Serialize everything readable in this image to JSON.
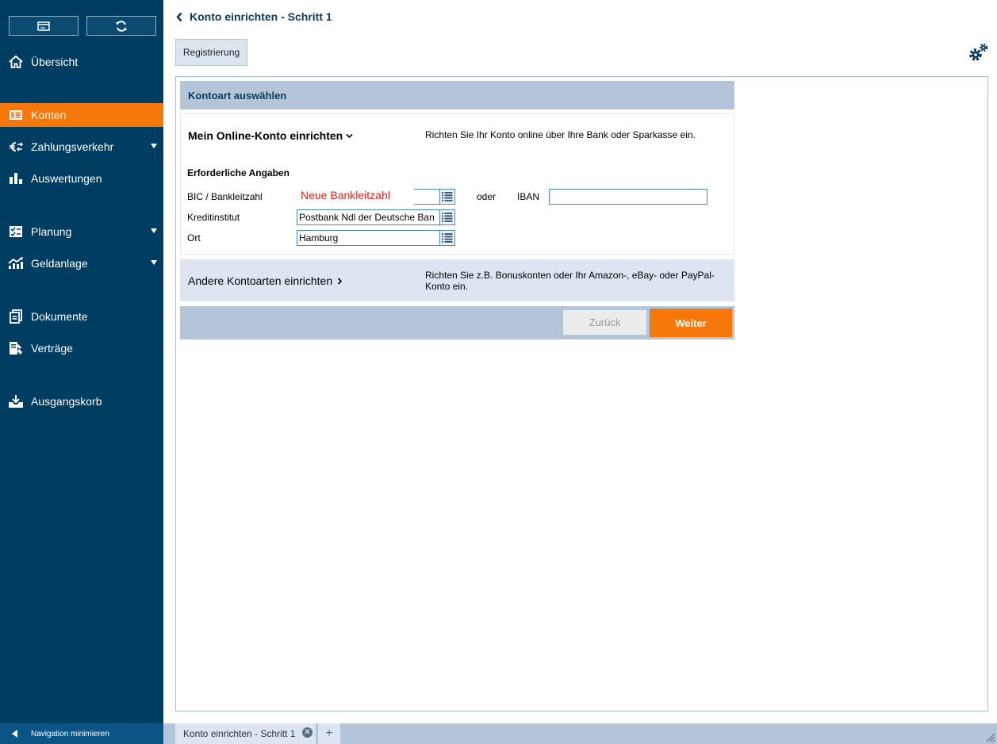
{
  "sidebar": {
    "items": [
      {
        "label": "Übersicht",
        "icon": "home-icon"
      },
      {
        "label": "Konten",
        "icon": "accounts-icon"
      },
      {
        "label": "Zahlungsverkehr",
        "icon": "euro-transfer-icon"
      },
      {
        "label": "Auswertungen",
        "icon": "bar-chart-icon"
      },
      {
        "label": "Planung",
        "icon": "checklist-icon"
      },
      {
        "label": "Geldanlage",
        "icon": "growth-chart-icon"
      },
      {
        "label": "Dokumente",
        "icon": "documents-icon"
      },
      {
        "label": "Verträge",
        "icon": "contracts-icon"
      },
      {
        "label": "Ausgangskorb",
        "icon": "outbox-icon"
      }
    ],
    "minimize_label": "Navigation minimieren"
  },
  "header": {
    "title": "Konto einrichten - Schritt 1",
    "tab_label": "Registrierung"
  },
  "main": {
    "section_title": "Kontoart auswählen",
    "online": {
      "title": "Mein Online-Konto einrichten",
      "description": "Richten Sie Ihr Konto online über Ihre Bank oder Sparkasse ein.",
      "required_label": "Erforderliche Angaben",
      "bic_label": "BIC / Bankleitzahl",
      "bic_overlay": "Neue Bankleitzahl",
      "bic_value": "",
      "or_label": "oder",
      "iban_label": "IBAN",
      "iban_value": "",
      "institute_label": "Kreditinstitut",
      "institute_value": "Postbank Ndl der Deutsche Ban",
      "city_label": "Ort",
      "city_value": "Hamburg"
    },
    "other": {
      "title": "Andere Kontoarten einrichten",
      "description": "Richten Sie z.B. Bonuskonten oder Ihr Amazon-, eBay- oder PayPal-Konto ein."
    },
    "buttons": {
      "back": "Zurück",
      "next": "Weiter"
    }
  },
  "tabs": [
    {
      "label": "Konto einrichten - Schritt 1"
    }
  ],
  "colors": {
    "sidebar_bg": "#003d62",
    "accent": "#f6780a",
    "section_bg": "#b5c5d9",
    "title_color": "#0d3a5c"
  }
}
